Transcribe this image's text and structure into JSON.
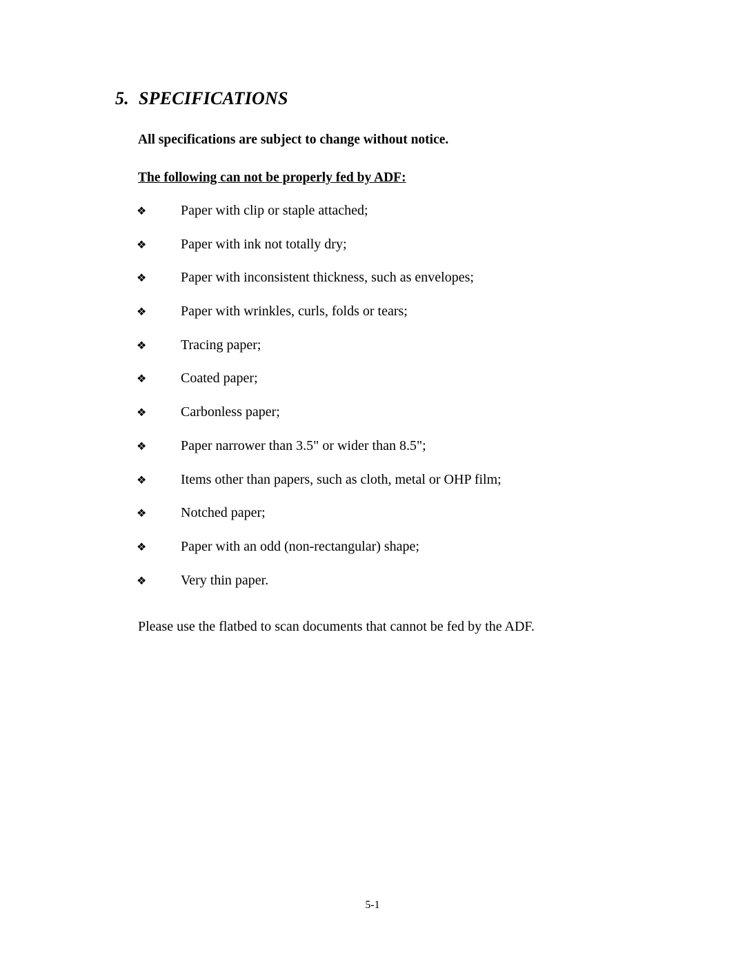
{
  "heading": {
    "number": "5.",
    "title": "SPECIFICATIONS"
  },
  "notice": "All specifications are subject to change without notice.",
  "subheading": "The following can not be properly fed by ADF:",
  "bullet_icon": "❖",
  "items": [
    "Paper with clip or staple attached;",
    "Paper with ink not totally dry;",
    "Paper with inconsistent thickness, such as envelopes;",
    "Paper with wrinkles, curls, folds or tears;",
    "Tracing paper;",
    "Coated paper;",
    "Carbonless paper;",
    "Paper narrower than 3.5\" or wider than 8.5\";",
    "Items other than papers, such as cloth, metal or OHP film;",
    "Notched paper;",
    "Paper with an odd (non-rectangular) shape;",
    "Very thin paper."
  ],
  "closing": "Please use the flatbed to scan documents that cannot be fed by the ADF.",
  "page_number": "5-1"
}
